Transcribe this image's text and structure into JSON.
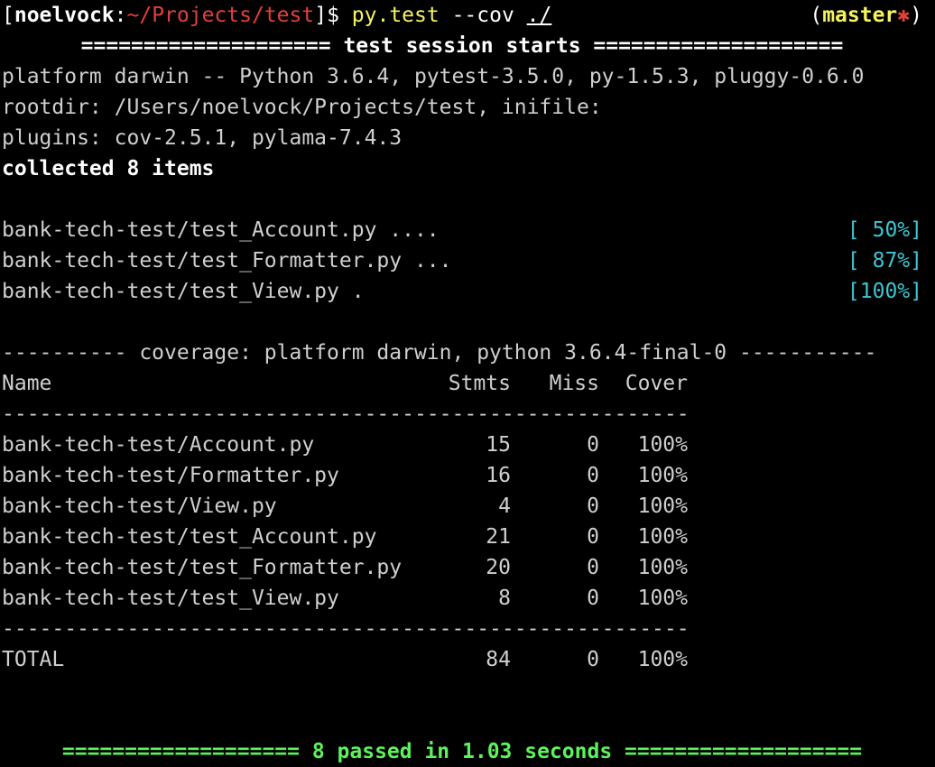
{
  "prompt": {
    "open_bracket": "[",
    "user": "noelvock",
    "colon": ":",
    "path": "~/Projects/test",
    "close_bracket": "]",
    "dollar": "$ ",
    "command": "py.test",
    "args": " --cov ",
    "target": "./",
    "branch_open": "(",
    "branch": "master",
    "dirty_mark": "✱",
    "branch_close": ")"
  },
  "session": {
    "header": "==================== test session starts ====================",
    "platform": "platform darwin -- Python 3.6.4, pytest-3.5.0, py-1.5.3, pluggy-0.6.0",
    "rootdir": "rootdir: /Users/noelvock/Projects/test, inifile:",
    "plugins": "plugins: cov-2.5.1, pylama-7.4.3",
    "collected": "collected 8 items"
  },
  "test_files": [
    {
      "name": "bank-tech-test/test_Account.py ....",
      "progress": "[ 50%]"
    },
    {
      "name": "bank-tech-test/test_Formatter.py ...",
      "progress": "[ 87%]"
    },
    {
      "name": "bank-tech-test/test_View.py .",
      "progress": "[100%]"
    }
  ],
  "coverage": {
    "header": "---------- coverage: platform darwin, python 3.6.4-final-0 -----------",
    "columns": {
      "name": "Name",
      "stmts": "Stmts",
      "miss": "Miss",
      "cover": "Cover"
    },
    "separator": "-------------------------------------------------------",
    "rows": [
      {
        "name": "bank-tech-test/Account.py",
        "stmts": "15",
        "miss": "0",
        "cover": "100%"
      },
      {
        "name": "bank-tech-test/Formatter.py",
        "stmts": "16",
        "miss": "0",
        "cover": "100%"
      },
      {
        "name": "bank-tech-test/View.py",
        "stmts": "4",
        "miss": "0",
        "cover": "100%"
      },
      {
        "name": "bank-tech-test/test_Account.py",
        "stmts": "21",
        "miss": "0",
        "cover": "100%"
      },
      {
        "name": "bank-tech-test/test_Formatter.py",
        "stmts": "20",
        "miss": "0",
        "cover": "100%"
      },
      {
        "name": "bank-tech-test/test_View.py",
        "stmts": "8",
        "miss": "0",
        "cover": "100%"
      }
    ],
    "total": {
      "name": "TOTAL",
      "stmts": "84",
      "miss": "0",
      "cover": "100%"
    }
  },
  "summary": "=================== 8 passed in 1.03 seconds ===================",
  "colors": {
    "background": "#000000",
    "text": "#cfcfcf",
    "path": "#e0413a",
    "command": "#f6f35f",
    "pass": "#5df25b",
    "progress": "#3fc5d3"
  }
}
